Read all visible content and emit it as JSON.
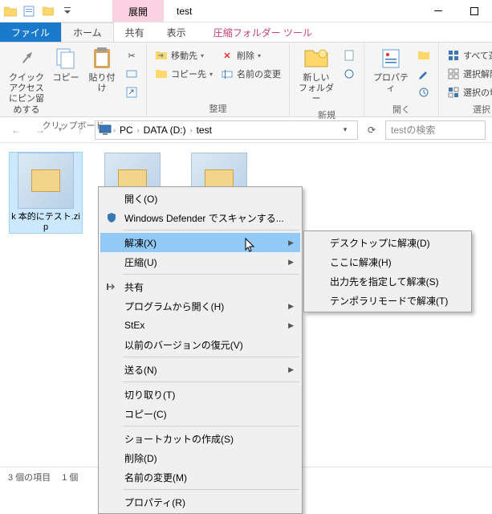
{
  "titlebar": {
    "context_label": "展開",
    "title": "test"
  },
  "tabs": {
    "file": "ファイル",
    "home": "ホーム",
    "share": "共有",
    "view": "表示",
    "context": "圧縮フォルダー ツール"
  },
  "ribbon": {
    "clipboard": {
      "pin": "クイック アクセス\nにピン留めする",
      "copy": "コピー",
      "paste": "貼り付け",
      "label": "クリップボード"
    },
    "organize": {
      "moveto": "移動先",
      "delete": "削除",
      "copyto": "コピー先",
      "rename": "名前の変更",
      "label": "整理"
    },
    "new": {
      "newfolder": "新しい\nフォルダー",
      "label": "新規"
    },
    "open": {
      "properties": "プロパティ",
      "label": "開く"
    },
    "select": {
      "all": "すべて選択",
      "none": "選択解除",
      "invert": "選択の切り替",
      "label": "選択"
    }
  },
  "address": {
    "root": "PC",
    "drive": "DATA (D:)",
    "folder": "test",
    "search_placeholder": "testの検索"
  },
  "files": {
    "item1": "k 本的にテスト.zip"
  },
  "status": {
    "count": "3 個の項目",
    "sel": "1 個"
  },
  "contextmenu": {
    "open": "開く(O)",
    "defender": "Windows Defender でスキャンする...",
    "extract": "解凍(X)",
    "compress": "圧縮(U)",
    "share": "共有",
    "openwith": "プログラムから開く(H)",
    "stex": "StEx",
    "prevver": "以前のバージョンの復元(V)",
    "sendto": "送る(N)",
    "cut": "切り取り(T)",
    "copy": "コピー(C)",
    "shortcut": "ショートカットの作成(S)",
    "delete": "削除(D)",
    "rename": "名前の変更(M)",
    "properties": "プロパティ(R)"
  },
  "submenu": {
    "desktop": "デスクトップに解凍(D)",
    "here": "ここに解凍(H)",
    "specify": "出力先を指定して解凍(S)",
    "temp": "テンポラリモードで解凍(T)"
  }
}
